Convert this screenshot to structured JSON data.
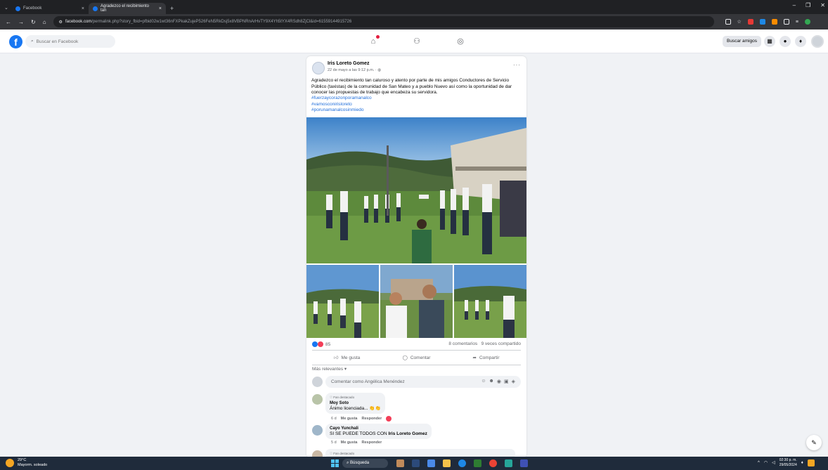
{
  "browser": {
    "tabs": [
      {
        "label": "Facebook",
        "active": false
      },
      {
        "label": "Agradezco el recibimiento tan",
        "active": true
      }
    ],
    "address": {
      "host": "facebook.com",
      "path": "/permalink.php?story_fbid=pfbid02w1wt36nFXPkakZujeP526FeN5RkDsj5x8VBPNRnArHvTY9X4Yh5tYX4RSdh8ZjCl&id=61559144915726"
    }
  },
  "fb": {
    "search_placeholder": "Buscar en Facebook",
    "find_friends": "Buscar amigos"
  },
  "post": {
    "author": "Iris Loreto Gomez",
    "time": "22 de mayo a las 9:12 p.m. · ",
    "caption": "Agradezco el recibimiento tan caluroso y atento por parte de mis amigos Conductores de Servicio Público (taxistas) de la comunidad de San Mateo y a pueblo Nuevo así como la oportunidad de dar conocer las propuestas de trabajo que encabeza su servidora.",
    "hashtags": [
      "#fuerzaycorazonporamanalco",
      "#vamosconirisloreto",
      "#porunamanalcosinmiedo"
    ],
    "reaction_count": "85",
    "comments_count": "8 comentarios",
    "shares_count": "9 veces compartido",
    "actions": {
      "like": "Me gusta",
      "comment": "Comentar",
      "share": "Compartir"
    },
    "sort_label": "Más relevantes",
    "comment_placeholder": "Comentar como Angélica Menéndez"
  },
  "comments": [
    {
      "badge": "Fan destacado",
      "name": "Moy Soto",
      "text": "Ánimo licenciada... 👏👏",
      "age": "6 d",
      "like": "Me gusta",
      "reply": "Responder"
    },
    {
      "badge": "",
      "name": "Cayo Yunchali",
      "text_prefix": "SI SE PUEDE TODOS CON ",
      "text_mention": "Iris Loreto Gomez",
      "age": "5 d",
      "like": "Me gusta",
      "reply": "Responder"
    },
    {
      "badge": "Fan destacado"
    }
  ],
  "taskbar": {
    "temp": "29°C",
    "weather": "Mayorm. soleado",
    "search": "Búsqueda",
    "time": "02:30 p. m.",
    "date": "29/05/2024"
  },
  "colors": {
    "fb_blue": "#1877f2",
    "link": "#216fdb",
    "taskbar": "#1f2b3b"
  }
}
